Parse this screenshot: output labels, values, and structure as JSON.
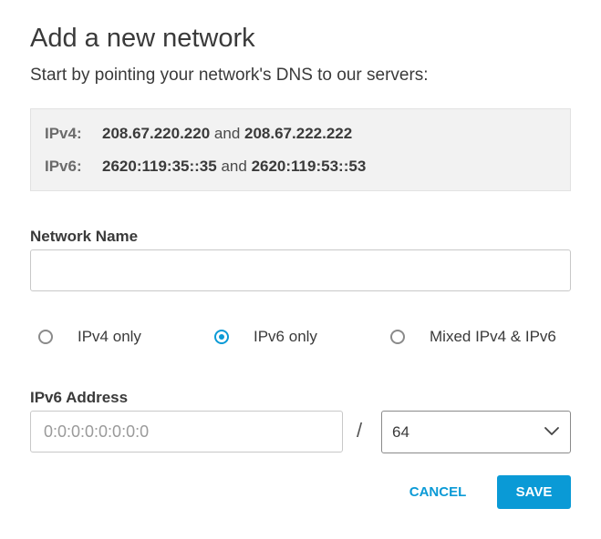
{
  "dialog": {
    "title": "Add a new network",
    "subtitle": "Start by pointing your network's DNS to our servers:"
  },
  "dns": {
    "ipv4": {
      "label": "IPv4:",
      "primary": "208.67.220.220",
      "joiner": "and",
      "secondary": "208.67.222.222"
    },
    "ipv6": {
      "label": "IPv6:",
      "primary": "2620:119:35::35",
      "joiner": "and",
      "secondary": "2620:119:53::53"
    }
  },
  "network_name": {
    "label": "Network Name",
    "value": "",
    "placeholder": ""
  },
  "protocol": {
    "options": [
      {
        "label": "IPv4 only",
        "selected": false
      },
      {
        "label": "IPv6 only",
        "selected": true
      },
      {
        "label": "Mixed IPv4 & IPv6",
        "selected": false
      }
    ]
  },
  "ipv6_address": {
    "label": "IPv6 Address",
    "value": "",
    "placeholder": "0:0:0:0:0:0:0:0",
    "separator": "/",
    "prefix_selected": "64"
  },
  "actions": {
    "cancel_label": "CANCEL",
    "save_label": "SAVE"
  },
  "colors": {
    "accent": "#0a9ad6",
    "dns_box_bg": "#f2f2f2",
    "text": "#3a3a3a"
  },
  "icons": {
    "select_chevron": "chevron-down-icon"
  }
}
